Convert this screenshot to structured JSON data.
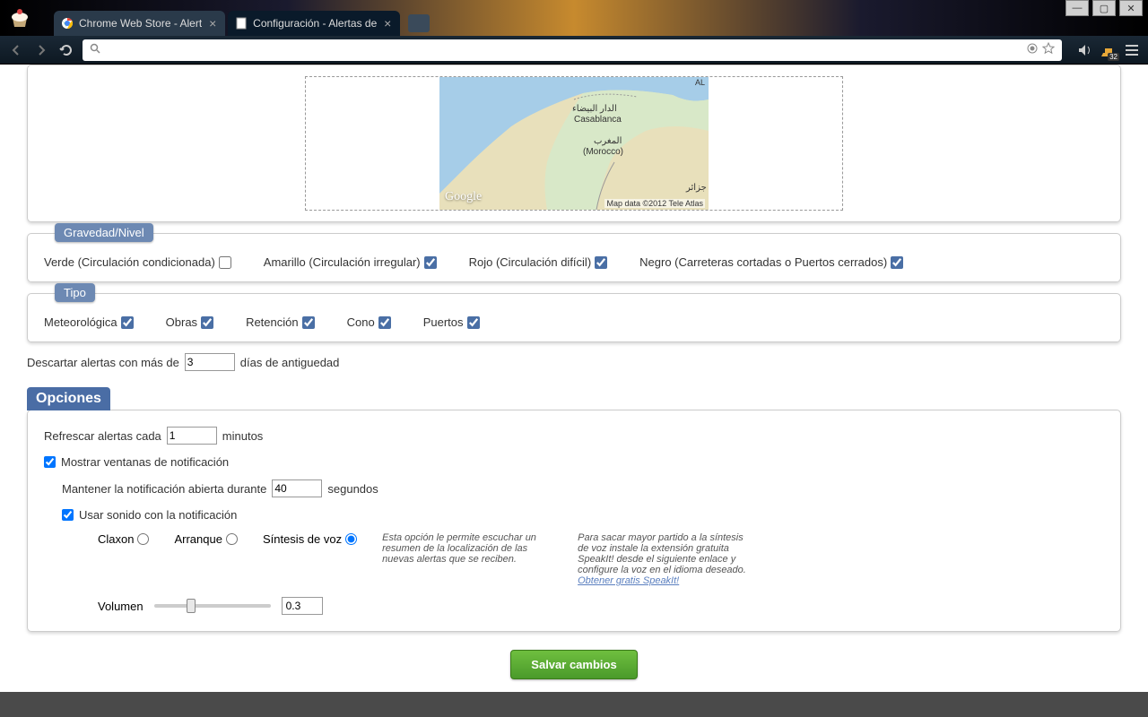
{
  "window": {
    "tabs": [
      {
        "title": "Chrome Web Store - Alert",
        "favicon": "chrome-store"
      },
      {
        "title": "Configuración - Alertas de",
        "favicon": "page"
      }
    ],
    "win_controls": {
      "min": "—",
      "max": "▢",
      "close": "✕"
    }
  },
  "toolbar": {
    "url": ""
  },
  "ext": {
    "count_badge": "32"
  },
  "map": {
    "labels": {
      "casablanca_ar": "الدار البيضاء",
      "casablanca": "Casablanca",
      "morocco_ar": "المغرب",
      "morocco": "(Morocco)",
      "algeria_ar": "جزائر",
      "al": "AL"
    },
    "logo": "Google",
    "attribution": "Map data ©2012 Tele Atlas"
  },
  "gravity": {
    "legend": "Gravedad/Nivel",
    "items": [
      {
        "label": "Verde (Circulación condicionada)",
        "checked": false
      },
      {
        "label": "Amarillo (Circulación irregular)",
        "checked": true
      },
      {
        "label": "Rojo (Circulación difícil)",
        "checked": true
      },
      {
        "label": "Negro (Carreteras cortadas o Puertos cerrados)",
        "checked": true
      }
    ]
  },
  "type": {
    "legend": "Tipo",
    "items": [
      {
        "label": "Meteorológica",
        "checked": true
      },
      {
        "label": "Obras",
        "checked": true
      },
      {
        "label": "Retención",
        "checked": true
      },
      {
        "label": "Cono",
        "checked": true
      },
      {
        "label": "Puertos",
        "checked": true
      }
    ]
  },
  "discard": {
    "prefix": "Descartar alertas con más de",
    "value": "3",
    "suffix": "días de antiguedad"
  },
  "options": {
    "header": "Opciones",
    "refresh_prefix": "Refrescar alertas cada",
    "refresh_value": "1",
    "refresh_suffix": "minutos",
    "show_notif": {
      "label": "Mostrar ventanas de notificación",
      "checked": true
    },
    "keep_prefix": "Mantener la notificación abierta durante",
    "keep_value": "40",
    "keep_suffix": "segundos",
    "use_sound": {
      "label": "Usar sonido con la notificación",
      "checked": true
    },
    "sounds": {
      "claxon": "Claxon",
      "arranque": "Arranque",
      "sintesis": "Síntesis de voz",
      "selected": "sintesis",
      "hint1": "Esta opción le permite escuchar un resumen de la localización de las nuevas alertas que se reciben.",
      "hint2_a": "Para sacar mayor partido a la síntesis de voz instale la extensión gratuita SpeakIt! desde el siguiente enlace y configure la voz en el idioma deseado. ",
      "hint2_link": "Obtener gratis SpeakIt!"
    },
    "volume": {
      "label": "Volumen",
      "value": "0.3"
    }
  },
  "save": {
    "label": "Salvar cambios"
  }
}
